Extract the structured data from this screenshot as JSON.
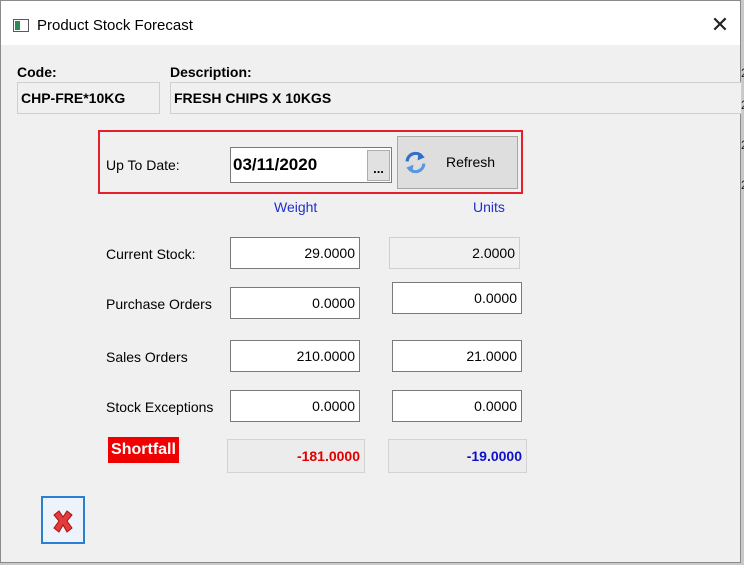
{
  "window": {
    "title": "Product Stock Forecast"
  },
  "header": {
    "code_label": "Code:",
    "code_value": "CHP-FRE*10KG",
    "description_label": "Description:",
    "description_value": "FRESH CHIPS X  10KGS"
  },
  "filter": {
    "up_to_date_label": "Up To Date:",
    "date_value": "03/11/2020",
    "ellipsis_label": "...",
    "refresh_label": "Refresh"
  },
  "columns": {
    "weight": "Weight",
    "units": "Units"
  },
  "rows": [
    {
      "label": "Current Stock:",
      "weight": "29.0000",
      "units": "2.0000"
    },
    {
      "label": "Purchase Orders",
      "weight": "0.0000",
      "units": "0.0000"
    },
    {
      "label": "Sales Orders",
      "weight": "210.0000",
      "units": "21.0000"
    },
    {
      "label": "Stock Exceptions",
      "weight": "0.0000",
      "units": "0.0000"
    }
  ],
  "shortfall": {
    "label": "Shortfall",
    "weight": "-181.0000",
    "units": "-19.0000"
  },
  "colors": {
    "highlight_border": "#e3202b",
    "column_header": "#1f2fcf",
    "shortfall_badge": "#f00000",
    "shortfall_weight": "#e00000",
    "shortfall_units": "#1010c8"
  },
  "icons": {
    "app": "app-window-icon",
    "close": "close-icon",
    "refresh": "refresh-icon",
    "exit": "red-x-icon"
  }
}
